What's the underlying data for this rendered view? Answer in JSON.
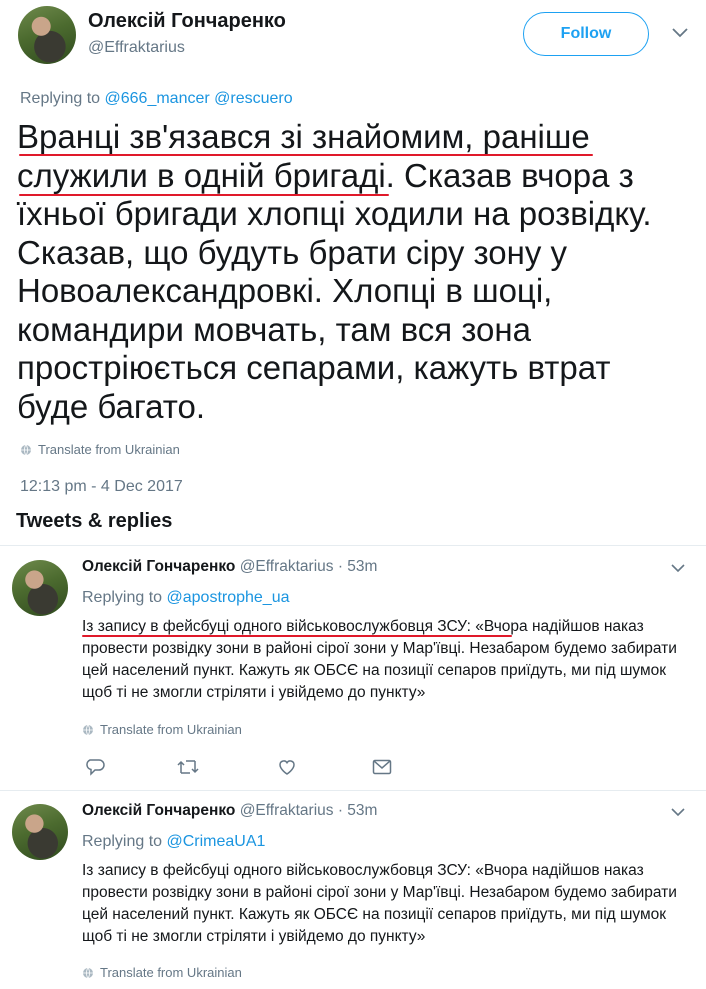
{
  "main_tweet": {
    "author_name": "Олексій Гончаренко",
    "author_handle": "@Effraktarius",
    "follow_label": "Follow",
    "replying_prefix": "Replying to",
    "replying_to": "@666_mancer @rescuero",
    "text": "Вранці зв'язався зі знайомим, раніше служили в одній бригаді. Сказав вчора з їхньої бригади хлопці ходили на розвідку. Сказав, що будуть брати сіру зону у Новоалександровкі. Хлопці в шоці, командири мовчать, там вся зона простріюється сепарами, кажуть втрат буде багато.",
    "translate_label": "Translate from Ukrainian",
    "timestamp": "12:13 pm - 4 Dec 2017"
  },
  "section_title": "Tweets & replies",
  "replies": [
    {
      "author_name": "Олексій Гончаренко",
      "author_handle": "@Effraktarius",
      "time": "· 53m",
      "replying_prefix": "Replying to",
      "replying_to": "@apostrophe_ua",
      "text": "Із запису в фейсбуці одного військовослужбовця ЗСУ: «Вчора надійшов наказ провести розвідку зони в районі сірої зони у Мар'ївці. Незабаром будемо забирати цей населений пункт. Кажуть як ОБСЄ на позиції сепаров приїдуть, ми під шумок щоб ті не змогли стріляти і увійдемо до пункту»",
      "translate_label": "Translate from Ukrainian"
    },
    {
      "author_name": "Олексій Гончаренко",
      "author_handle": "@Effraktarius",
      "time": "· 53m",
      "replying_prefix": "Replying to",
      "replying_to": "@CrimeaUA1",
      "text": "Із запису в фейсбуці одного військовослужбовця ЗСУ: «Вчора надійшов наказ провести розвідку зони в районі сірої зони у Мар'ївці. Незабаром будемо забирати цей населений пункт. Кажуть як ОБСЄ на позиції сепаров приїдуть, ми під шумок щоб ті не змогли стріляти і увійдемо до пункту»",
      "translate_label": "Translate from Ukrainian"
    }
  ],
  "colors": {
    "link": "#1b95e0",
    "muted": "#657786",
    "annotation_red": "#e0192a",
    "follow_blue": "#1da1f2"
  },
  "icons": [
    "globe-icon",
    "chevron-down-icon",
    "reply-icon",
    "retweet-icon",
    "like-icon",
    "message-icon"
  ]
}
